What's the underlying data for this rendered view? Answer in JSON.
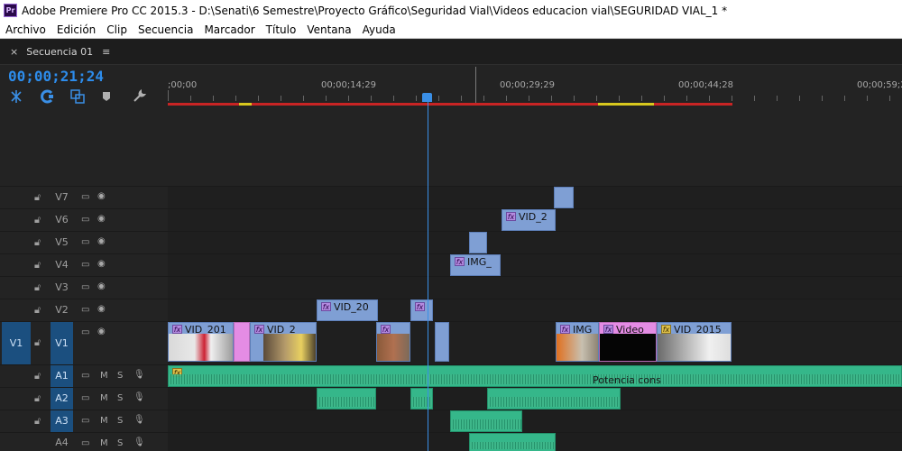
{
  "window": {
    "app_icon": "Pr",
    "title": "Adobe Premiere Pro CC 2015.3 - D:\\Senati\\6 Semestre\\Proyecto Gráfico\\Seguridad Vial\\Videos educacion vial\\SEGURIDAD VIAL_1 *"
  },
  "menu": [
    "Archivo",
    "Edición",
    "Clip",
    "Secuencia",
    "Marcador",
    "Título",
    "Ventana",
    "Ayuda"
  ],
  "panel": {
    "tab_close": "×",
    "tab_title": "Secuencia 01",
    "tab_menu": "≡",
    "timecode": "00;00;21;24"
  },
  "ruler": {
    "labels": [
      ";00;00",
      "00;00;14;29",
      "00;00;29;29",
      "00;00;44;28",
      "00;00;59;2"
    ]
  },
  "tracks": {
    "video": [
      {
        "name": "V7"
      },
      {
        "name": "V6"
      },
      {
        "name": "V5"
      },
      {
        "name": "V4"
      },
      {
        "name": "V3"
      },
      {
        "name": "V2"
      },
      {
        "name": "V1",
        "source": "V1"
      }
    ],
    "audio": [
      {
        "name": "A1",
        "m": "M",
        "s": "S"
      },
      {
        "name": "A2",
        "m": "M",
        "s": "S"
      },
      {
        "name": "A3",
        "m": "M",
        "s": "S"
      },
      {
        "name": "A4",
        "m": "M",
        "s": "S"
      }
    ]
  },
  "clips": {
    "v6": "VID_2",
    "v4": "IMG_",
    "v2": "VID_20",
    "v1a": "VID_201",
    "v1b": "VID_2",
    "v1c": "IMG",
    "v1d": "Video",
    "v1e": "VID_2015",
    "a1_label": "Potencia cons",
    "fx": "fx"
  },
  "colors": {
    "timecode": "#2d8ceb",
    "video_clip": "#7f9fd4",
    "audio_clip": "#35b78a",
    "title_clip": "#e48ce4",
    "track_target": "#1b4f7f"
  }
}
